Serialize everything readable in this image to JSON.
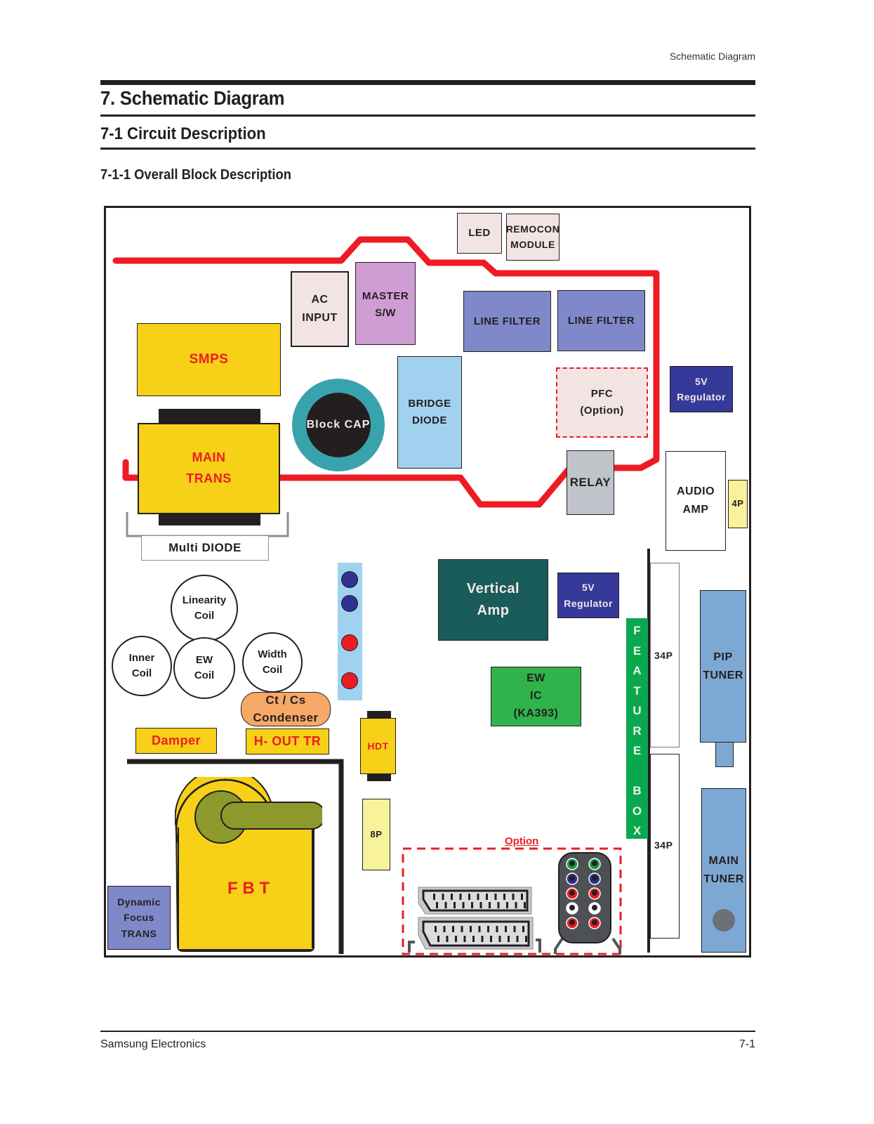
{
  "header": {
    "running_head": "Schematic Diagram",
    "chapter_title": "7. Schematic Diagram",
    "section_title": "7-1  Circuit Description",
    "subsection_title": "7-1-1 Overall Block Description"
  },
  "footer": {
    "publisher": "Samsung Electronics",
    "page_number": "7-1"
  },
  "colors": {
    "power_line": "#ed1c24",
    "yellow_block": "#f6d117",
    "line_filter": "#7f88c9",
    "regulator": "#35399a",
    "vertical_amp": "#1a5c5a",
    "ew_ic": "#2fb34a",
    "feature_box": "#0aa84e",
    "tuner": "#7ea8d4",
    "bridge_diode": "#a0d2f0",
    "master_sw": "#cf9dd4",
    "pale_pink": "#f3e4e4",
    "relay": "#c0c3ca",
    "connector_pale": "#f8f29a",
    "condenser": "#f6a866",
    "block_cap_ring": "#38a3ad"
  },
  "blocks": {
    "led": {
      "lines": [
        "LED"
      ]
    },
    "remocon": {
      "lines": [
        "REMOCON",
        "MODULE"
      ]
    },
    "ac_input": {
      "lines": [
        "AC",
        "INPUT"
      ]
    },
    "master_sw": {
      "lines": [
        "MASTER",
        "S/W"
      ]
    },
    "line_filter_1": {
      "lines": [
        "LINE  FILTER"
      ]
    },
    "line_filter_2": {
      "lines": [
        "LINE  FILTER"
      ]
    },
    "smps": {
      "lines": [
        "SMPS"
      ]
    },
    "block_cap": {
      "lines": [
        "Block  CAP"
      ]
    },
    "bridge_diode": {
      "lines": [
        "BRIDGE",
        "DIODE"
      ]
    },
    "pfc": {
      "lines": [
        "PFC",
        "(Option)"
      ]
    },
    "regulator_top": {
      "lines": [
        "5V",
        "Regulator"
      ]
    },
    "main_trans": {
      "lines": [
        "MAIN",
        "TRANS"
      ]
    },
    "relay": {
      "lines": [
        "RELAY"
      ]
    },
    "audio_amp": {
      "lines": [
        "AUDIO",
        "AMP"
      ]
    },
    "connector_4p": {
      "lines": [
        "4P"
      ]
    },
    "multi_diode": {
      "lines": [
        "Multi  DIODE"
      ]
    },
    "vertical_amp": {
      "lines": [
        "Vertical",
        "Amp"
      ]
    },
    "regulator_mid": {
      "lines": [
        "5V",
        "Regulator"
      ]
    },
    "linearity_coil": {
      "lines": [
        "Linearity",
        "Coil"
      ]
    },
    "inner_coil": {
      "lines": [
        "Inner",
        "Coil"
      ]
    },
    "ew_coil": {
      "lines": [
        "EW",
        "Coil"
      ]
    },
    "width_coil": {
      "lines": [
        "Width",
        "Coil"
      ]
    },
    "ew_ic": {
      "lines": [
        "EW",
        "IC",
        "(KA393)"
      ]
    },
    "condenser": {
      "lines": [
        "Ct  /  Cs",
        "Condenser"
      ]
    },
    "damper": {
      "lines": [
        "Damper"
      ]
    },
    "h_out_tr": {
      "lines": [
        "H- OUT  TR"
      ]
    },
    "hdt": {
      "lines": [
        "HDT"
      ]
    },
    "connector_8p": {
      "lines": [
        "8P"
      ]
    },
    "fbt": {
      "lines": [
        "F  B  T"
      ]
    },
    "dynamic_focus": {
      "lines": [
        "Dynamic",
        "Focus",
        "TRANS"
      ]
    },
    "feature_box": {
      "letters": [
        "F",
        "E",
        "A",
        "T",
        "U",
        "R",
        "E",
        "",
        "B",
        "O",
        "X"
      ]
    },
    "connector_34p_top": {
      "lines": [
        "34P"
      ]
    },
    "connector_34p_bottom": {
      "lines": [
        "34P"
      ]
    },
    "pip_tuner": {
      "lines": [
        "PIP",
        "TUNER"
      ]
    },
    "main_tuner": {
      "lines": [
        "MAIN",
        "TUNER"
      ]
    },
    "option_label": "Option"
  },
  "indicator_dots": [
    "#2e3192",
    "#2e3192",
    "#ed1c24",
    "#ed1c24"
  ],
  "rca_jacks": [
    [
      "#1a9b48",
      "#1a9b48"
    ],
    [
      "#2e3192",
      "#2e3192"
    ],
    [
      "#ed1c24",
      "#ed1c24"
    ],
    [
      "#ffffff",
      "#ffffff"
    ],
    [
      "#ed1c24",
      "#ed1c24"
    ]
  ]
}
